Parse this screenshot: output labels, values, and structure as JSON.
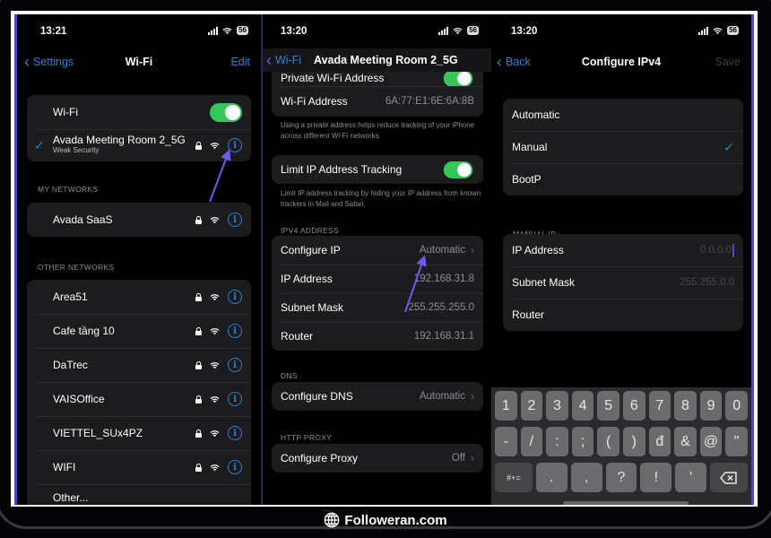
{
  "brand": {
    "icon": "globe-icon",
    "text": "Followeran.com"
  },
  "wifi_screen": {
    "status_time": "13:21",
    "battery": "56",
    "nav": {
      "back_label": "Settings",
      "title": "Wi-Fi",
      "right_label": "Edit"
    },
    "wifi_toggle_label": "Wi-Fi",
    "wifi_enabled": true,
    "connected": {
      "name": "Avada Meeting Room 2_5G",
      "subtitle": "Weak Security"
    },
    "my_networks_header": "MY NETWORKS",
    "my_networks": [
      {
        "name": "Avada SaaS"
      }
    ],
    "other_networks_header": "OTHER NETWORKS",
    "other_networks": [
      {
        "name": "Area51"
      },
      {
        "name": "Cafe tầng 10"
      },
      {
        "name": "DaTrec"
      },
      {
        "name": "VAISOffice"
      },
      {
        "name": "VIETTEL_SUx4PZ"
      },
      {
        "name": "WIFI"
      }
    ],
    "other_label": "Other..."
  },
  "network_detail_screen": {
    "status_time": "13:20",
    "battery": "56",
    "nav": {
      "back_label": "Wi-Fi",
      "title": "Avada Meeting Room 2_5G"
    },
    "private_address_label": "Private Wi-Fi Address",
    "private_address_enabled": true,
    "wifi_address_label": "Wi-Fi Address",
    "wifi_address_value": "6A:77:E1:6E:6A:8B",
    "private_footer": "Using a private address helps reduce tracking of your iPhone across different Wi-Fi networks.",
    "limit_tracking_label": "Limit IP Address Tracking",
    "limit_tracking_enabled": true,
    "limit_footer": "Limit IP address tracking by hiding your IP address from known trackers in Mail and Safari.",
    "ipv4_header": "IPV4 ADDRESS",
    "ipv4_rows": [
      {
        "label": "Configure IP",
        "value": "Automatic",
        "chevron": true
      },
      {
        "label": "IP Address",
        "value": "192.168.31.8"
      },
      {
        "label": "Subnet Mask",
        "value": "255.255.255.0"
      },
      {
        "label": "Router",
        "value": "192.168.31.1"
      }
    ],
    "dns_header": "DNS",
    "dns_row": {
      "label": "Configure DNS",
      "value": "Automatic"
    },
    "proxy_header": "HTTP PROXY",
    "proxy_row": {
      "label": "Configure Proxy",
      "value": "Off"
    }
  },
  "configure_ipv4_screen": {
    "status_time": "13:20",
    "battery": "56",
    "nav": {
      "back_label": "Back",
      "title": "Configure IPv4",
      "right_label": "Save"
    },
    "options": [
      {
        "label": "Automatic",
        "selected": false
      },
      {
        "label": "Manual",
        "selected": true
      },
      {
        "label": "BootP",
        "selected": false
      }
    ],
    "manual_header": "MANUAL IP",
    "manual_fields": [
      {
        "label": "IP Address",
        "placeholder": "0.0.0.0"
      },
      {
        "label": "Subnet Mask",
        "placeholder": "255.255.0.0"
      },
      {
        "label": "Router",
        "placeholder": ""
      }
    ],
    "keyboard": {
      "row1": [
        "1",
        "2",
        "3",
        "4",
        "5",
        "6",
        "7",
        "8",
        "9",
        "0"
      ],
      "row2": [
        "-",
        "/",
        ":",
        ";",
        "(",
        ")",
        "đ",
        "&",
        "@",
        "\""
      ],
      "row3": [
        ".",
        ",",
        "?",
        "!",
        "'"
      ],
      "symbols_key": "#+=",
      "delete_key": "delete-icon"
    }
  },
  "colors": {
    "accent": "#2f7fd6",
    "toggle_on": "#34c759",
    "annotation": "#6a5cf0"
  }
}
